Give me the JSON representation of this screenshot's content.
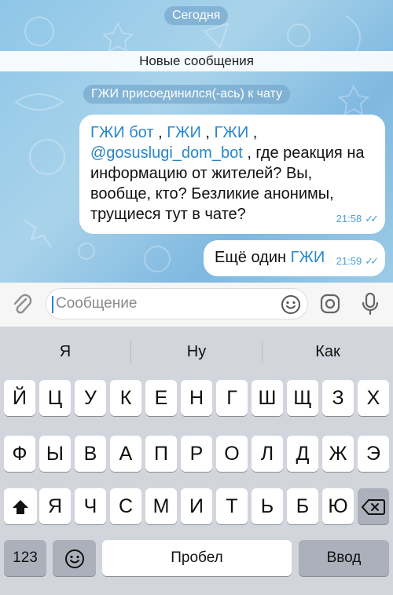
{
  "chat": {
    "date_pill": "Сегодня",
    "new_messages_bar": "Новые сообщения",
    "join_notice": {
      "name": "ГЖИ",
      "text": "присоединился(-ась) к чату"
    },
    "messages": [
      {
        "parts": [
          {
            "t": "ГЖИ бот",
            "m": true
          },
          {
            "t": " , ",
            "m": false
          },
          {
            "t": "ГЖИ",
            "m": true
          },
          {
            "t": " , ",
            "m": false
          },
          {
            "t": "ГЖИ",
            "m": true
          },
          {
            "t": " ,",
            "m": false
          },
          {
            "br": true
          },
          {
            "t": "@gosuslugi_dom_bot",
            "m": true
          },
          {
            "t": " , где реакция на информацию от жителей? Вы, вообще, кто? Безликие анонимы, трущиеся тут в чате?",
            "m": false
          }
        ],
        "time": "21:58"
      },
      {
        "parts": [
          {
            "t": "Ещё один ",
            "m": false
          },
          {
            "t": "ГЖИ",
            "m": true
          }
        ],
        "time": "21:59"
      }
    ]
  },
  "input": {
    "placeholder": "Сообщение"
  },
  "icons": {
    "attach": "paperclip-icon",
    "emoji": "emoji-icon",
    "camera": "camera-icon",
    "mic": "microphone-icon",
    "shift": "shift-arrow-icon",
    "backspace": "backspace-icon",
    "emoji_key": "emoji-icon"
  },
  "colors": {
    "mention": "#2a86c8",
    "tick": "#4a9fd3",
    "bubble": "#ffffff"
  },
  "keyboard": {
    "suggestions": [
      "Я",
      "Ну",
      "Как"
    ],
    "row1": [
      "Й",
      "Ц",
      "У",
      "К",
      "Е",
      "Н",
      "Г",
      "Ш",
      "Щ",
      "З",
      "Х"
    ],
    "row2": [
      "Ф",
      "Ы",
      "В",
      "А",
      "П",
      "Р",
      "О",
      "Л",
      "Д",
      "Ж",
      "Э"
    ],
    "row3": [
      "Я",
      "Ч",
      "С",
      "М",
      "И",
      "Т",
      "Ь",
      "Б",
      "Ю"
    ],
    "numbers_label": "123",
    "space_label": "Пробел",
    "enter_label": "Ввод"
  }
}
